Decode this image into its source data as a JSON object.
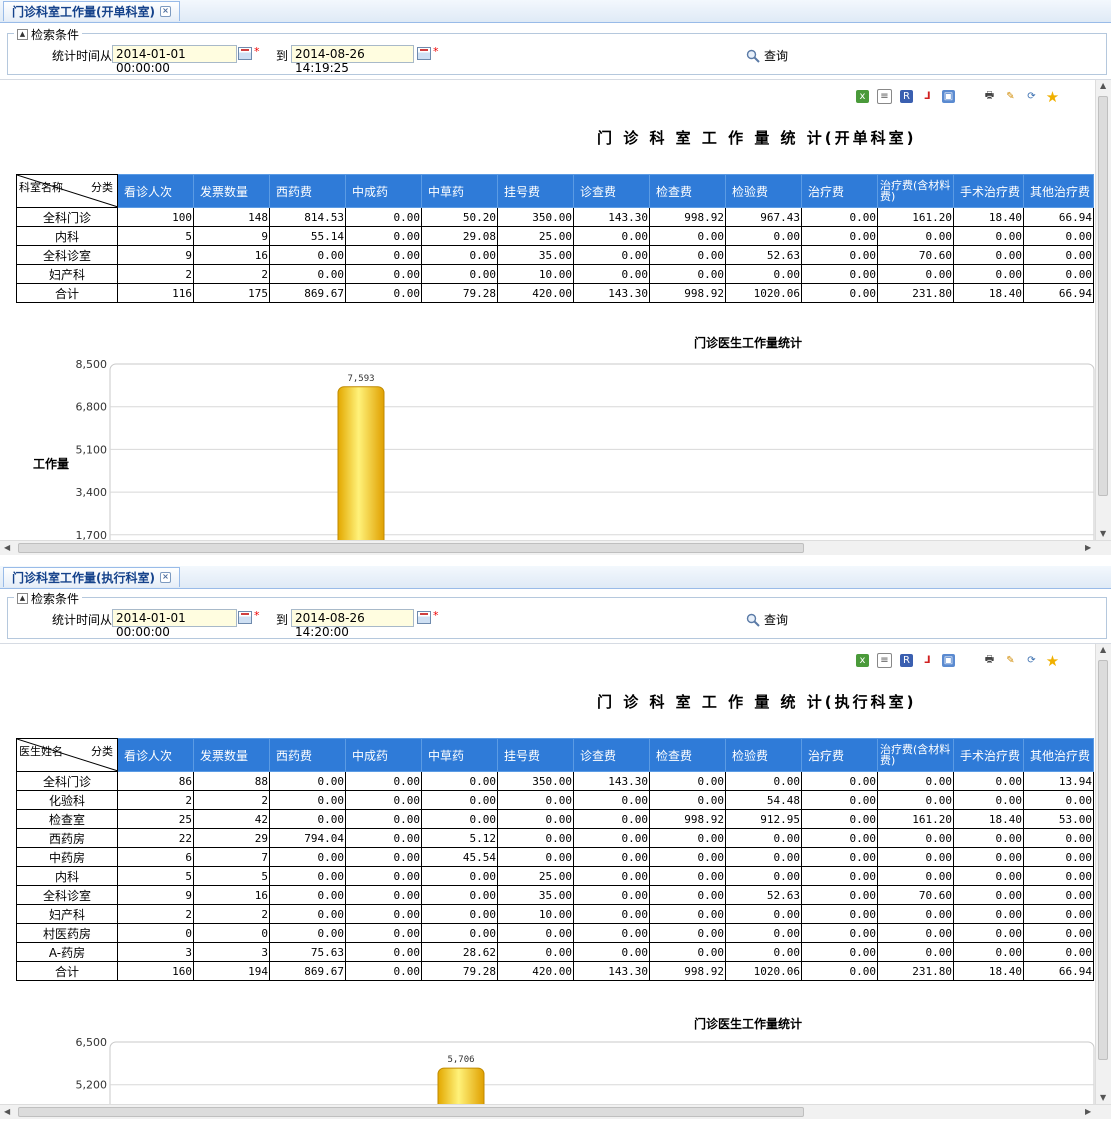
{
  "panels": [
    {
      "tab_title": "门诊科室工作量(开单科室)",
      "criteria_legend": "检索条件",
      "time_from_label": "统计时间从",
      "date_from": "2014-01-01 00:00:00",
      "to_label": "到",
      "date_to": "2014-08-26 14:19:25",
      "query_label": "查询",
      "report_title": "门 诊 科 室 工 作 量 统 计(开单科室)",
      "corner_left": "科室名称",
      "corner_right": "分类",
      "columns": [
        "看诊人次",
        "发票数量",
        "西药费",
        "中成药",
        "中草药",
        "挂号费",
        "诊查费",
        "检查费",
        "检验费",
        "治疗费",
        "治疗费(含材料费)",
        "手术治疗费",
        "其他治疗费"
      ],
      "rows": [
        [
          "全科门诊",
          "100",
          "148",
          "814.53",
          "0.00",
          "50.20",
          "350.00",
          "143.30",
          "998.92",
          "967.43",
          "0.00",
          "161.20",
          "18.40",
          "66.94"
        ],
        [
          "内科",
          "5",
          "9",
          "55.14",
          "0.00",
          "29.08",
          "25.00",
          "0.00",
          "0.00",
          "0.00",
          "0.00",
          "0.00",
          "0.00",
          "0.00"
        ],
        [
          "全科诊室",
          "9",
          "16",
          "0.00",
          "0.00",
          "0.00",
          "35.00",
          "0.00",
          "0.00",
          "52.63",
          "0.00",
          "70.60",
          "0.00",
          "0.00"
        ],
        [
          "妇产科",
          "2",
          "2",
          "0.00",
          "0.00",
          "0.00",
          "10.00",
          "0.00",
          "0.00",
          "0.00",
          "0.00",
          "0.00",
          "0.00",
          "0.00"
        ],
        [
          "合计",
          "116",
          "175",
          "869.67",
          "0.00",
          "79.28",
          "420.00",
          "143.30",
          "998.92",
          "1020.06",
          "0.00",
          "231.80",
          "18.40",
          "66.94"
        ]
      ],
      "chart_data": {
        "type": "bar",
        "title": "门诊医生工作量统计",
        "ylabel": "工作量",
        "yticks": [
          "8,500",
          "6,800",
          "5,100",
          "3,400",
          "1,700"
        ],
        "ylim_visible": [
          1700,
          8500
        ],
        "values": [
          7593
        ],
        "value_labels": [
          "7,593"
        ],
        "bar_color": "#f7c400"
      }
    },
    {
      "tab_title": "门诊科室工作量(执行科室)",
      "criteria_legend": "检索条件",
      "time_from_label": "统计时间从",
      "date_from": "2014-01-01 00:00:00",
      "to_label": "到",
      "date_to": "2014-08-26 14:20:00",
      "query_label": "查询",
      "report_title": "门 诊 科 室 工 作 量 统 计(执行科室)",
      "corner_left": "医生姓名",
      "corner_right": "分类",
      "columns": [
        "看诊人次",
        "发票数量",
        "西药费",
        "中成药",
        "中草药",
        "挂号费",
        "诊查费",
        "检查费",
        "检验费",
        "治疗费",
        "治疗费(含材料费)",
        "手术治疗费",
        "其他治疗费"
      ],
      "rows": [
        [
          "全科门诊",
          "86",
          "88",
          "0.00",
          "0.00",
          "0.00",
          "350.00",
          "143.30",
          "0.00",
          "0.00",
          "0.00",
          "0.00",
          "0.00",
          "13.94"
        ],
        [
          "化验科",
          "2",
          "2",
          "0.00",
          "0.00",
          "0.00",
          "0.00",
          "0.00",
          "0.00",
          "54.48",
          "0.00",
          "0.00",
          "0.00",
          "0.00"
        ],
        [
          "检查室",
          "25",
          "42",
          "0.00",
          "0.00",
          "0.00",
          "0.00",
          "0.00",
          "998.92",
          "912.95",
          "0.00",
          "161.20",
          "18.40",
          "53.00"
        ],
        [
          "西药房",
          "22",
          "29",
          "794.04",
          "0.00",
          "5.12",
          "0.00",
          "0.00",
          "0.00",
          "0.00",
          "0.00",
          "0.00",
          "0.00",
          "0.00"
        ],
        [
          "中药房",
          "6",
          "7",
          "0.00",
          "0.00",
          "45.54",
          "0.00",
          "0.00",
          "0.00",
          "0.00",
          "0.00",
          "0.00",
          "0.00",
          "0.00"
        ],
        [
          "内科",
          "5",
          "5",
          "0.00",
          "0.00",
          "0.00",
          "25.00",
          "0.00",
          "0.00",
          "0.00",
          "0.00",
          "0.00",
          "0.00",
          "0.00"
        ],
        [
          "全科诊室",
          "9",
          "16",
          "0.00",
          "0.00",
          "0.00",
          "35.00",
          "0.00",
          "0.00",
          "52.63",
          "0.00",
          "70.60",
          "0.00",
          "0.00"
        ],
        [
          "妇产科",
          "2",
          "2",
          "0.00",
          "0.00",
          "0.00",
          "10.00",
          "0.00",
          "0.00",
          "0.00",
          "0.00",
          "0.00",
          "0.00",
          "0.00"
        ],
        [
          "村医药房",
          "0",
          "0",
          "0.00",
          "0.00",
          "0.00",
          "0.00",
          "0.00",
          "0.00",
          "0.00",
          "0.00",
          "0.00",
          "0.00",
          "0.00"
        ],
        [
          "A-药房",
          "3",
          "3",
          "75.63",
          "0.00",
          "28.62",
          "0.00",
          "0.00",
          "0.00",
          "0.00",
          "0.00",
          "0.00",
          "0.00",
          "0.00"
        ],
        [
          "合计",
          "160",
          "194",
          "869.67",
          "0.00",
          "79.28",
          "420.00",
          "143.30",
          "998.92",
          "1020.06",
          "0.00",
          "231.80",
          "18.40",
          "66.94"
        ]
      ],
      "chart_data": {
        "type": "bar",
        "title": "门诊医生工作量统计",
        "ylabel": "",
        "yticks": [
          "6,500",
          "5,200"
        ],
        "ylim_visible": [
          5200,
          6500
        ],
        "values": [
          5706
        ],
        "value_labels": [
          "5,706"
        ],
        "bar_color": "#f7c400"
      }
    }
  ]
}
